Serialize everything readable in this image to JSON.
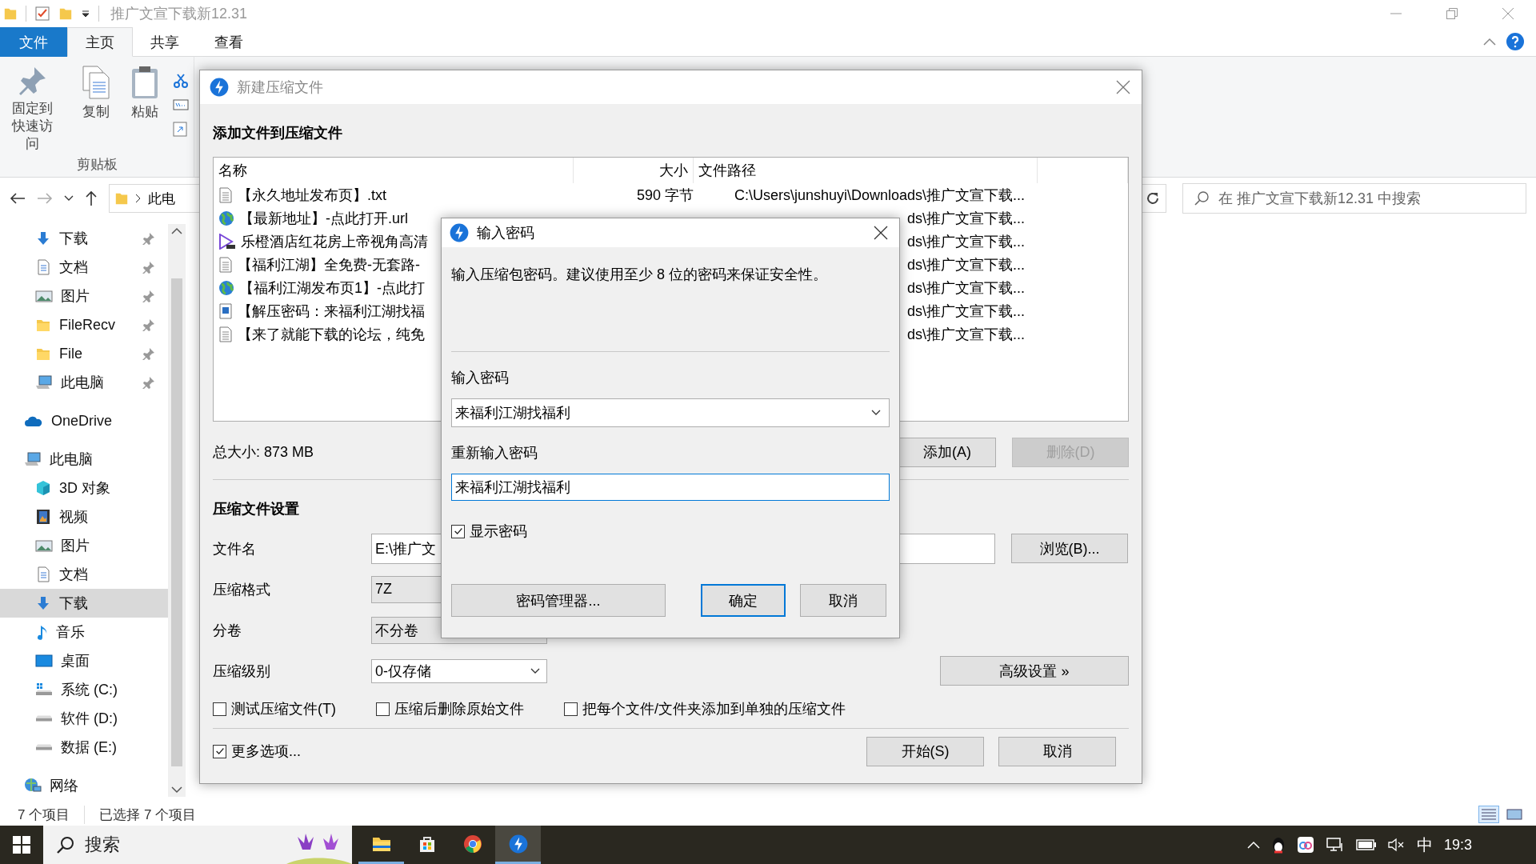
{
  "explorer": {
    "title": "推广文宣下载新12.31",
    "ribbon_tabs": [
      {
        "label": "文件",
        "kind": "file",
        "selected": false
      },
      {
        "label": "主页",
        "kind": "tab",
        "selected": true
      },
      {
        "label": "共享",
        "kind": "tab",
        "selected": false
      },
      {
        "label": "查看",
        "kind": "tab",
        "selected": false
      }
    ],
    "ribbon_buttons": [
      {
        "label": "固定到快速访问",
        "kind": "pin"
      },
      {
        "label": "复制",
        "kind": "copy"
      },
      {
        "label": "粘贴",
        "kind": "paste"
      }
    ],
    "ribbon_group": "剪贴板",
    "address": {
      "segment": "此电"
    },
    "search": {
      "placeholder": "在 推广文宣下载新12.31 中搜索"
    },
    "quick_access": [
      {
        "label": "下载",
        "kind": "download",
        "pinned": true,
        "selected": false
      },
      {
        "label": "文档",
        "kind": "document",
        "pinned": true,
        "selected": false
      },
      {
        "label": "图片",
        "kind": "picture",
        "pinned": true,
        "selected": false
      },
      {
        "label": "FileRecv",
        "kind": "folder",
        "pinned": true,
        "selected": false
      },
      {
        "label": "File",
        "kind": "folder",
        "pinned": true,
        "selected": false
      },
      {
        "label": "此电脑",
        "kind": "computer",
        "pinned": true,
        "selected": false
      }
    ],
    "tree": [
      {
        "label": "OneDrive",
        "kind": "cloud",
        "selected": false
      },
      {
        "label": "此电脑",
        "kind": "computer",
        "selected": false,
        "children": [
          {
            "label": "3D 对象",
            "kind": "cube",
            "selected": false
          },
          {
            "label": "视频",
            "kind": "film",
            "selected": false
          },
          {
            "label": "图片",
            "kind": "picture",
            "selected": false
          },
          {
            "label": "文档",
            "kind": "document",
            "selected": false
          },
          {
            "label": "下载",
            "kind": "download",
            "selected": true
          },
          {
            "label": "音乐",
            "kind": "music",
            "selected": false
          },
          {
            "label": "桌面",
            "kind": "desktop",
            "selected": false
          },
          {
            "label": "系统 (C:)",
            "kind": "system-drive",
            "selected": false
          },
          {
            "label": "软件 (D:)",
            "kind": "drive",
            "selected": false
          },
          {
            "label": "数据 (E:)",
            "kind": "drive",
            "selected": false
          }
        ]
      },
      {
        "label": "网络",
        "kind": "network",
        "selected": false
      }
    ],
    "status_bar": {
      "count": "7 个项目",
      "selection": "已选择 7 个项目"
    }
  },
  "compress_dialog": {
    "title": "新建压缩文件",
    "heading": "添加文件到压缩文件",
    "columns": [
      "名称",
      "大小",
      "文件路径"
    ],
    "files": [
      {
        "name": "【永久地址发布页】.txt",
        "kind": "text",
        "size": "590 字节",
        "path": "C:\\Users\\junshuyi\\Downloads\\推广文宣下载..."
      },
      {
        "name": "【最新地址】-点此打开.url",
        "kind": "link",
        "path": "ds\\推广文宣下载..."
      },
      {
        "name": "乐橙酒店红花房上帝视角高清",
        "kind": "video",
        "path": "ds\\推广文宣下载..."
      },
      {
        "name": "【福利江湖】全免费-无套路-",
        "kind": "text",
        "path": "ds\\推广文宣下载..."
      },
      {
        "name": "【福利江湖发布页1】-点此打",
        "kind": "link",
        "path": "ds\\推广文宣下载..."
      },
      {
        "name": "【解压密码：来福利江湖找福",
        "kind": "image",
        "path": "ds\\推广文宣下载..."
      },
      {
        "name": "【来了就能下载的论坛，纯免",
        "kind": "text",
        "path": "ds\\推广文宣下载..."
      }
    ],
    "total": "总大小: 873 MB",
    "add_button": {
      "label": "添加(A)",
      "disabled": false
    },
    "delete_button": {
      "label": "删除(D)",
      "disabled": true
    },
    "settings_heading": "压缩文件设置",
    "filename": {
      "label": "文件名",
      "value": "E:\\推广文"
    },
    "browse_button": "浏览(B)...",
    "format": {
      "label": "压缩格式",
      "value": "7Z"
    },
    "volume": {
      "label": "分卷",
      "value": "不分卷"
    },
    "level": {
      "label": "压缩级别",
      "value": "0-仅存储"
    },
    "advanced_button": "高级设置 »",
    "options": [
      {
        "label": "测试压缩文件(T)",
        "checked": false
      },
      {
        "label": "压缩后删除原始文件",
        "checked": false
      },
      {
        "label": "把每个文件/文件夹添加到单独的压缩文件",
        "checked": false
      }
    ],
    "more_options": {
      "label": "更多选项...",
      "checked": true
    },
    "start_button": "开始(S)",
    "cancel_button": "取消"
  },
  "password_dialog": {
    "title": "输入密码",
    "message": "输入压缩包密码。建议使用至少 8 位的密码来保证安全性。",
    "password_label": "输入密码",
    "password": "来福利江湖找福利",
    "confirm_label": "重新输入密码",
    "confirm": "来福利江湖找福利",
    "show_password": {
      "label": "显示密码",
      "checked": true
    },
    "manager_button": "密码管理器...",
    "ok_button": "确定",
    "cancel_button": "取消"
  },
  "taskbar": {
    "search": {
      "placeholder": "搜索"
    },
    "apps": [
      {
        "kind": "explorer",
        "running": true,
        "selected": false
      },
      {
        "kind": "store",
        "running": false,
        "selected": false
      },
      {
        "kind": "chrome",
        "running": false,
        "selected": false
      },
      {
        "kind": "archiver",
        "running": true,
        "selected": true
      }
    ],
    "ime": "中",
    "clock": "19:3"
  }
}
